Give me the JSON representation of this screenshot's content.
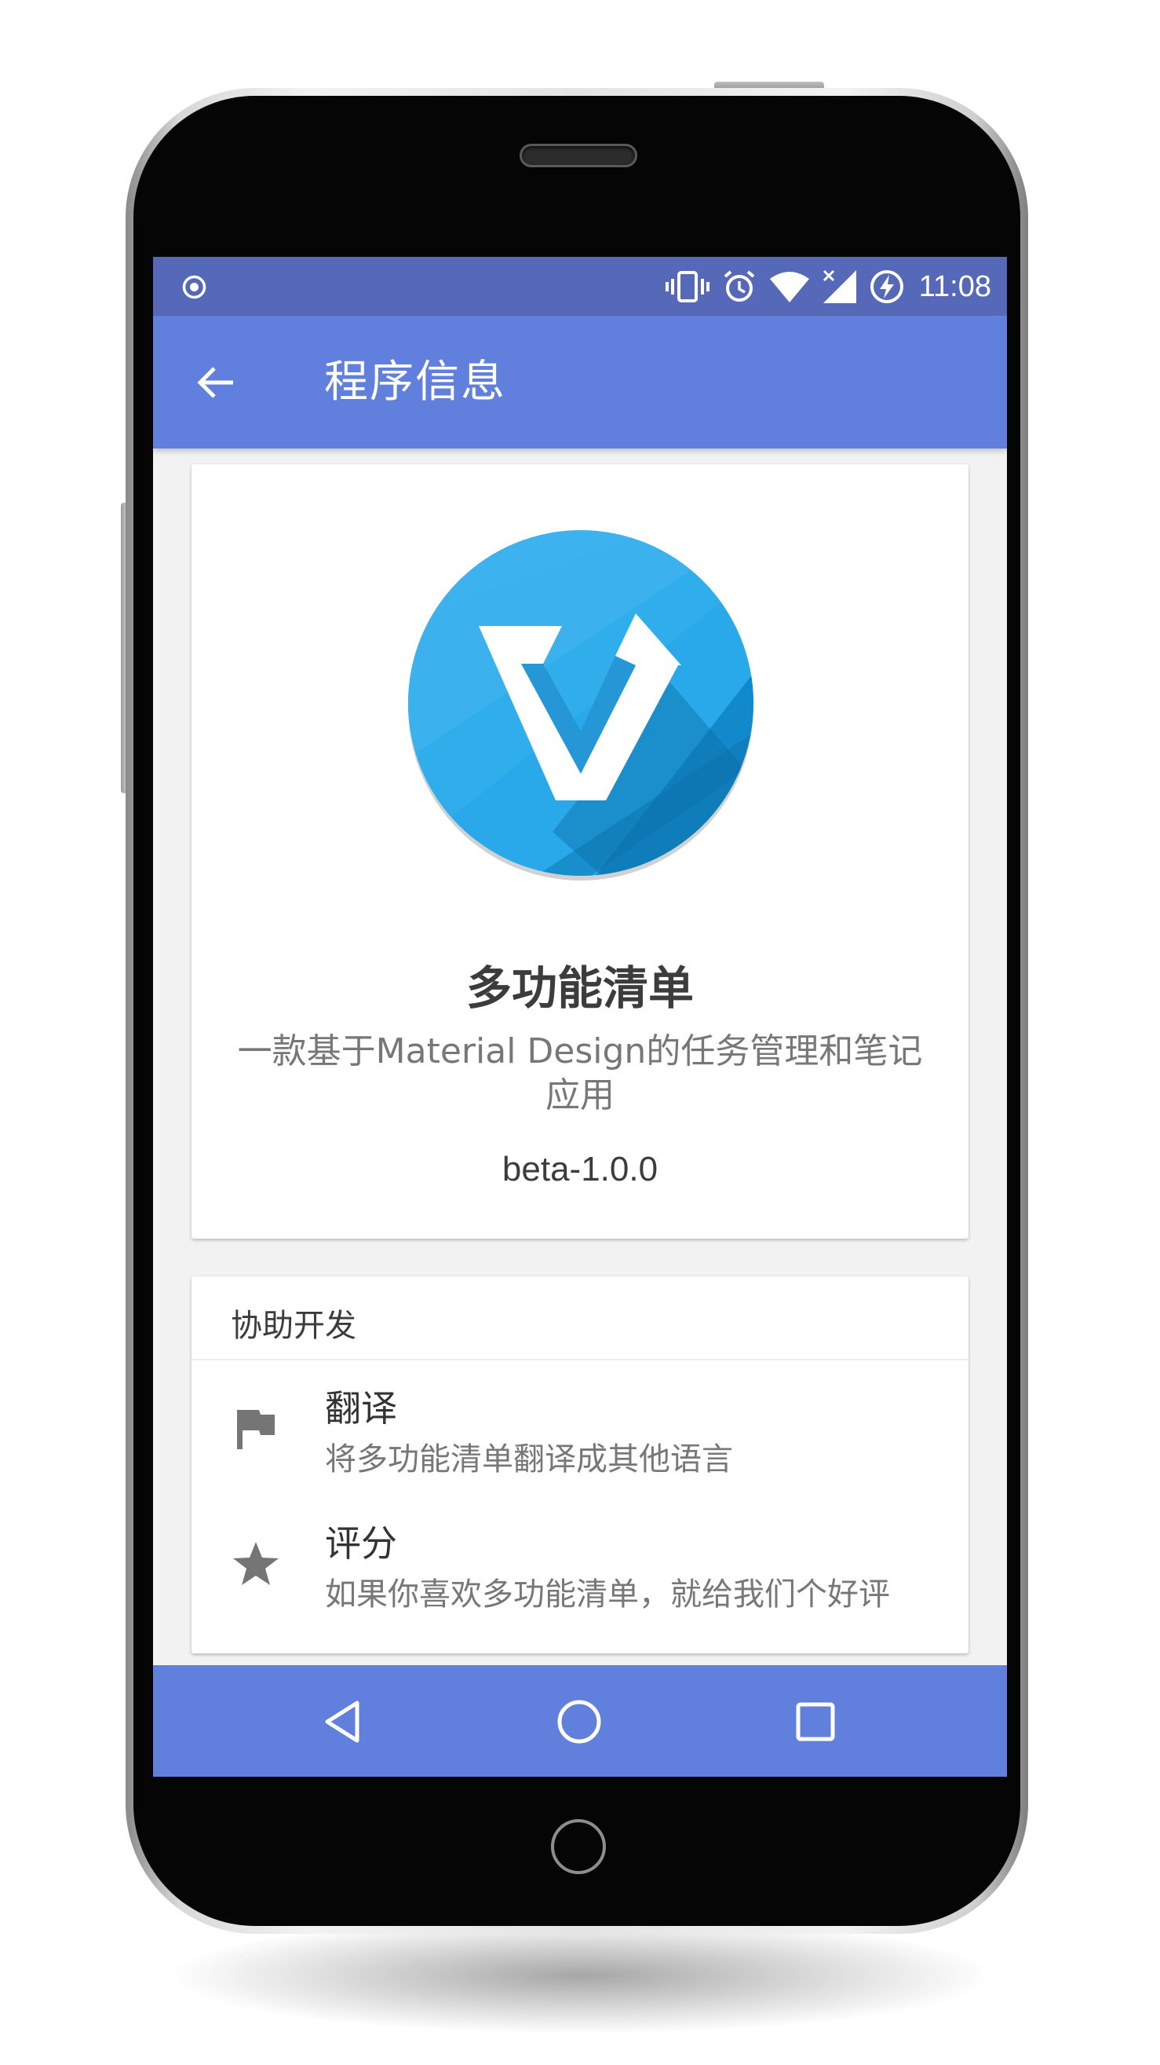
{
  "status_bar": {
    "time": "11:08",
    "icons": [
      "record-icon",
      "vibrate-icon",
      "alarm-icon",
      "wifi-icon",
      "signal-icon",
      "battery-charging-icon"
    ]
  },
  "app_bar": {
    "back_icon": "arrow-back-icon",
    "title": "程序信息"
  },
  "about_card": {
    "logo_icon": "app-logo-icon",
    "app_name": "多功能清单",
    "description": "一款基于Material Design的任务管理和笔记应用",
    "version": "beta-1.0.0"
  },
  "help_card": {
    "title": "协助开发",
    "items": [
      {
        "icon": "flag-icon",
        "label": "翻译",
        "subtitle": "将多功能清单翻译成其他语言"
      },
      {
        "icon": "star-icon",
        "label": "评分",
        "subtitle": "如果你喜欢多功能清单，就给我们个好评"
      }
    ]
  },
  "nav_bar": {
    "icons": [
      "nav-back-icon",
      "nav-home-icon",
      "nav-recents-icon"
    ]
  },
  "colors": {
    "status_bar": "#5569b8",
    "primary": "#6180dd",
    "logo_blue": "#29a9ea",
    "background": "#f2f2f2"
  }
}
